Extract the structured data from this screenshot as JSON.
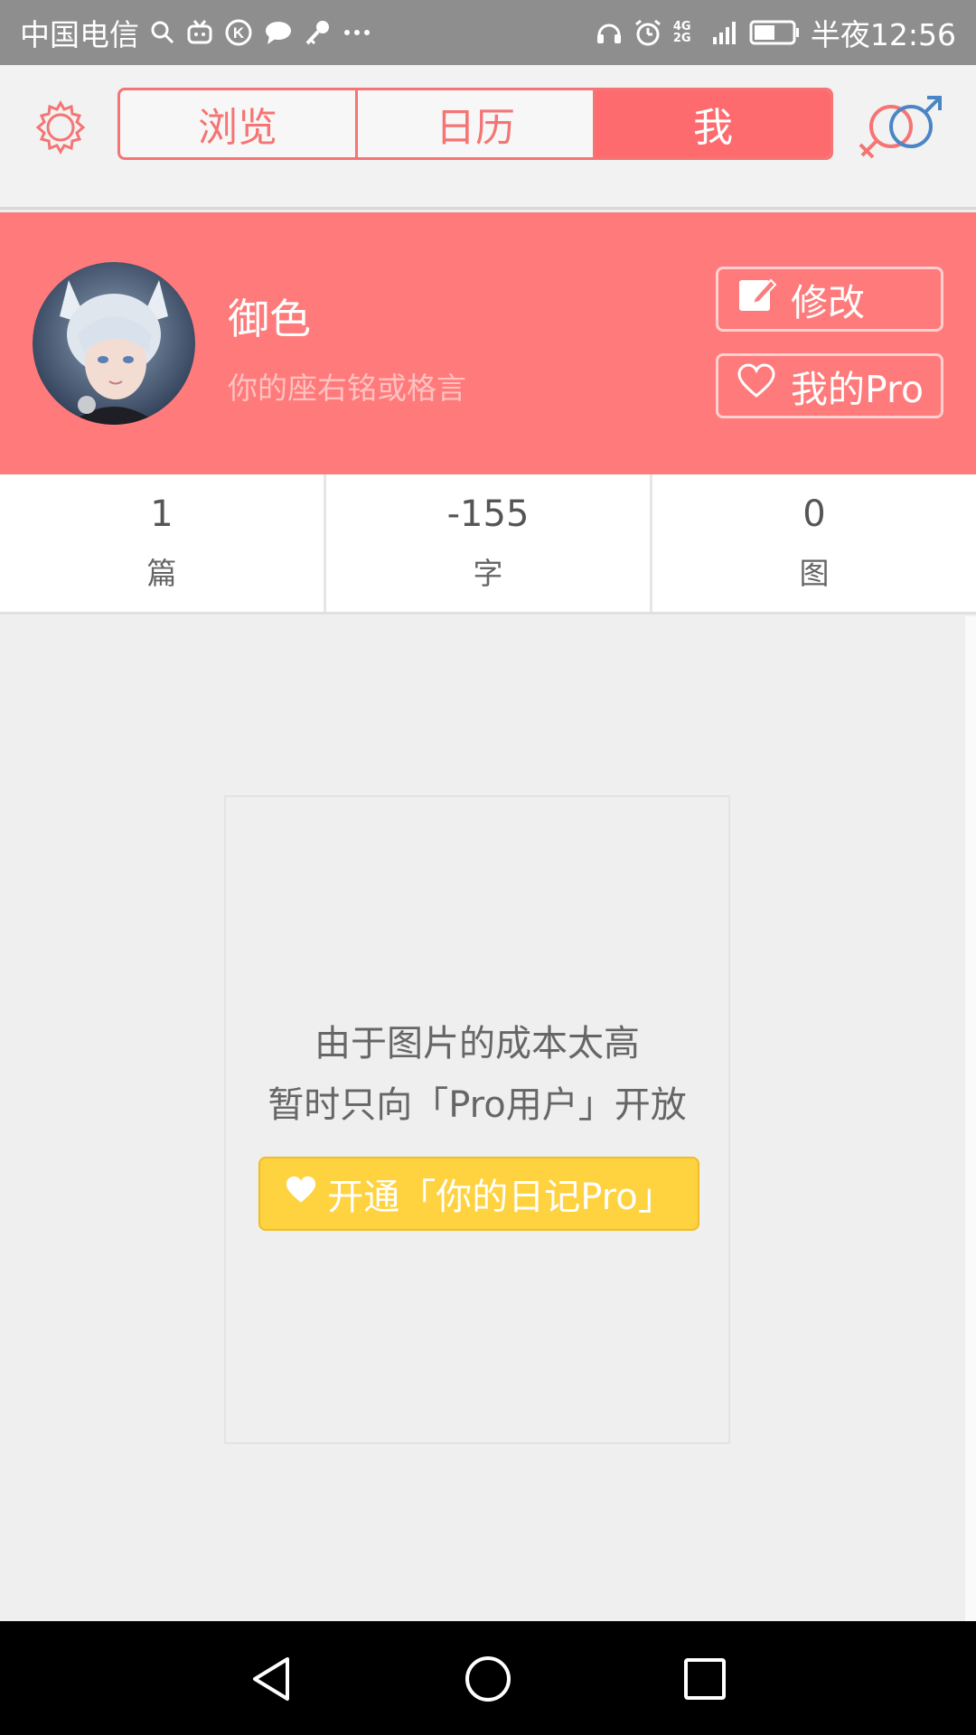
{
  "status_bar": {
    "carrier": "中国电信",
    "network": "4G 2G",
    "time_label": "半夜12:56"
  },
  "header": {
    "tabs": [
      {
        "label": "浏览",
        "active": false
      },
      {
        "label": "日历",
        "active": false
      },
      {
        "label": "我",
        "active": true
      }
    ]
  },
  "profile": {
    "username": "御色",
    "motto_placeholder": "你的座右铭或格言",
    "edit_label": "修改",
    "pro_label": "我的Pro"
  },
  "stats": [
    {
      "value": "1",
      "label": "篇"
    },
    {
      "value": "-155",
      "label": "字"
    },
    {
      "value": "0",
      "label": "图"
    }
  ],
  "pro_card": {
    "line1": "由于图片的成本太高",
    "line2": "暂时只向「Pro用户」开放",
    "button_label": "开通「你的日记Pro」"
  },
  "colors": {
    "accent": "#fe6b6f",
    "profile_bg": "#ff7a7a",
    "pro_button": "#ffd23f",
    "background": "#efefef"
  },
  "icons": [
    "search-icon",
    "tv-icon",
    "k-circle-icon",
    "chat-bubble-icon",
    "key-icon",
    "more-dots-icon",
    "headset-icon",
    "alarm-icon",
    "signal-icon",
    "battery-icon",
    "gear-icon",
    "gender-icon",
    "edit-icon",
    "heart-icon",
    "nav-back-icon",
    "nav-home-icon",
    "nav-recent-icon"
  ]
}
